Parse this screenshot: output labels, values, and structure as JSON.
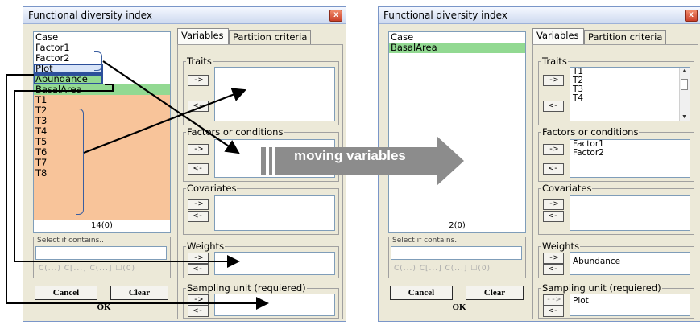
{
  "title": "Functional diversity index",
  "close_glyph": "x",
  "tabs": [
    "Variables",
    "Partition criteria"
  ],
  "groups": {
    "traits": "Traits",
    "factors": "Factors or conditions",
    "covariates": "Covariates",
    "weights": "Weights",
    "sampling": "Sampling unit (requiered)"
  },
  "arrow_add": "->",
  "arrow_remove": "<-",
  "arrow_add_disabled": "-->",
  "select_label": "Select if contains..",
  "radio_row": "C(...) C[...] C(...] ☐(0)",
  "buttons": {
    "cancel": "Cancel",
    "clear": "Clear",
    "ok": "OK"
  },
  "banner": "moving variables",
  "before": {
    "list": [
      "Case",
      "Factor1",
      "Factor2",
      "Plot",
      "Abundance",
      "BasalArea",
      "T1",
      "T2",
      "T3",
      "T4",
      "T5",
      "T6",
      "T7",
      "T8"
    ],
    "count": "14(0)"
  },
  "after": {
    "list": [
      "Case",
      "BasalArea"
    ],
    "count": "2(0)",
    "traits": [
      "T1",
      "T2",
      "T3",
      "T4"
    ],
    "factors": [
      "Factor1",
      "Factor2"
    ],
    "weights": [
      "Abundance"
    ],
    "sampling": [
      "Plot"
    ]
  },
  "colors": {
    "highlight_green": "#92d992",
    "highlight_orange": "#f8c49a",
    "annotation": "#3a5ea0",
    "banner_arrow": "#8c8c8c"
  }
}
